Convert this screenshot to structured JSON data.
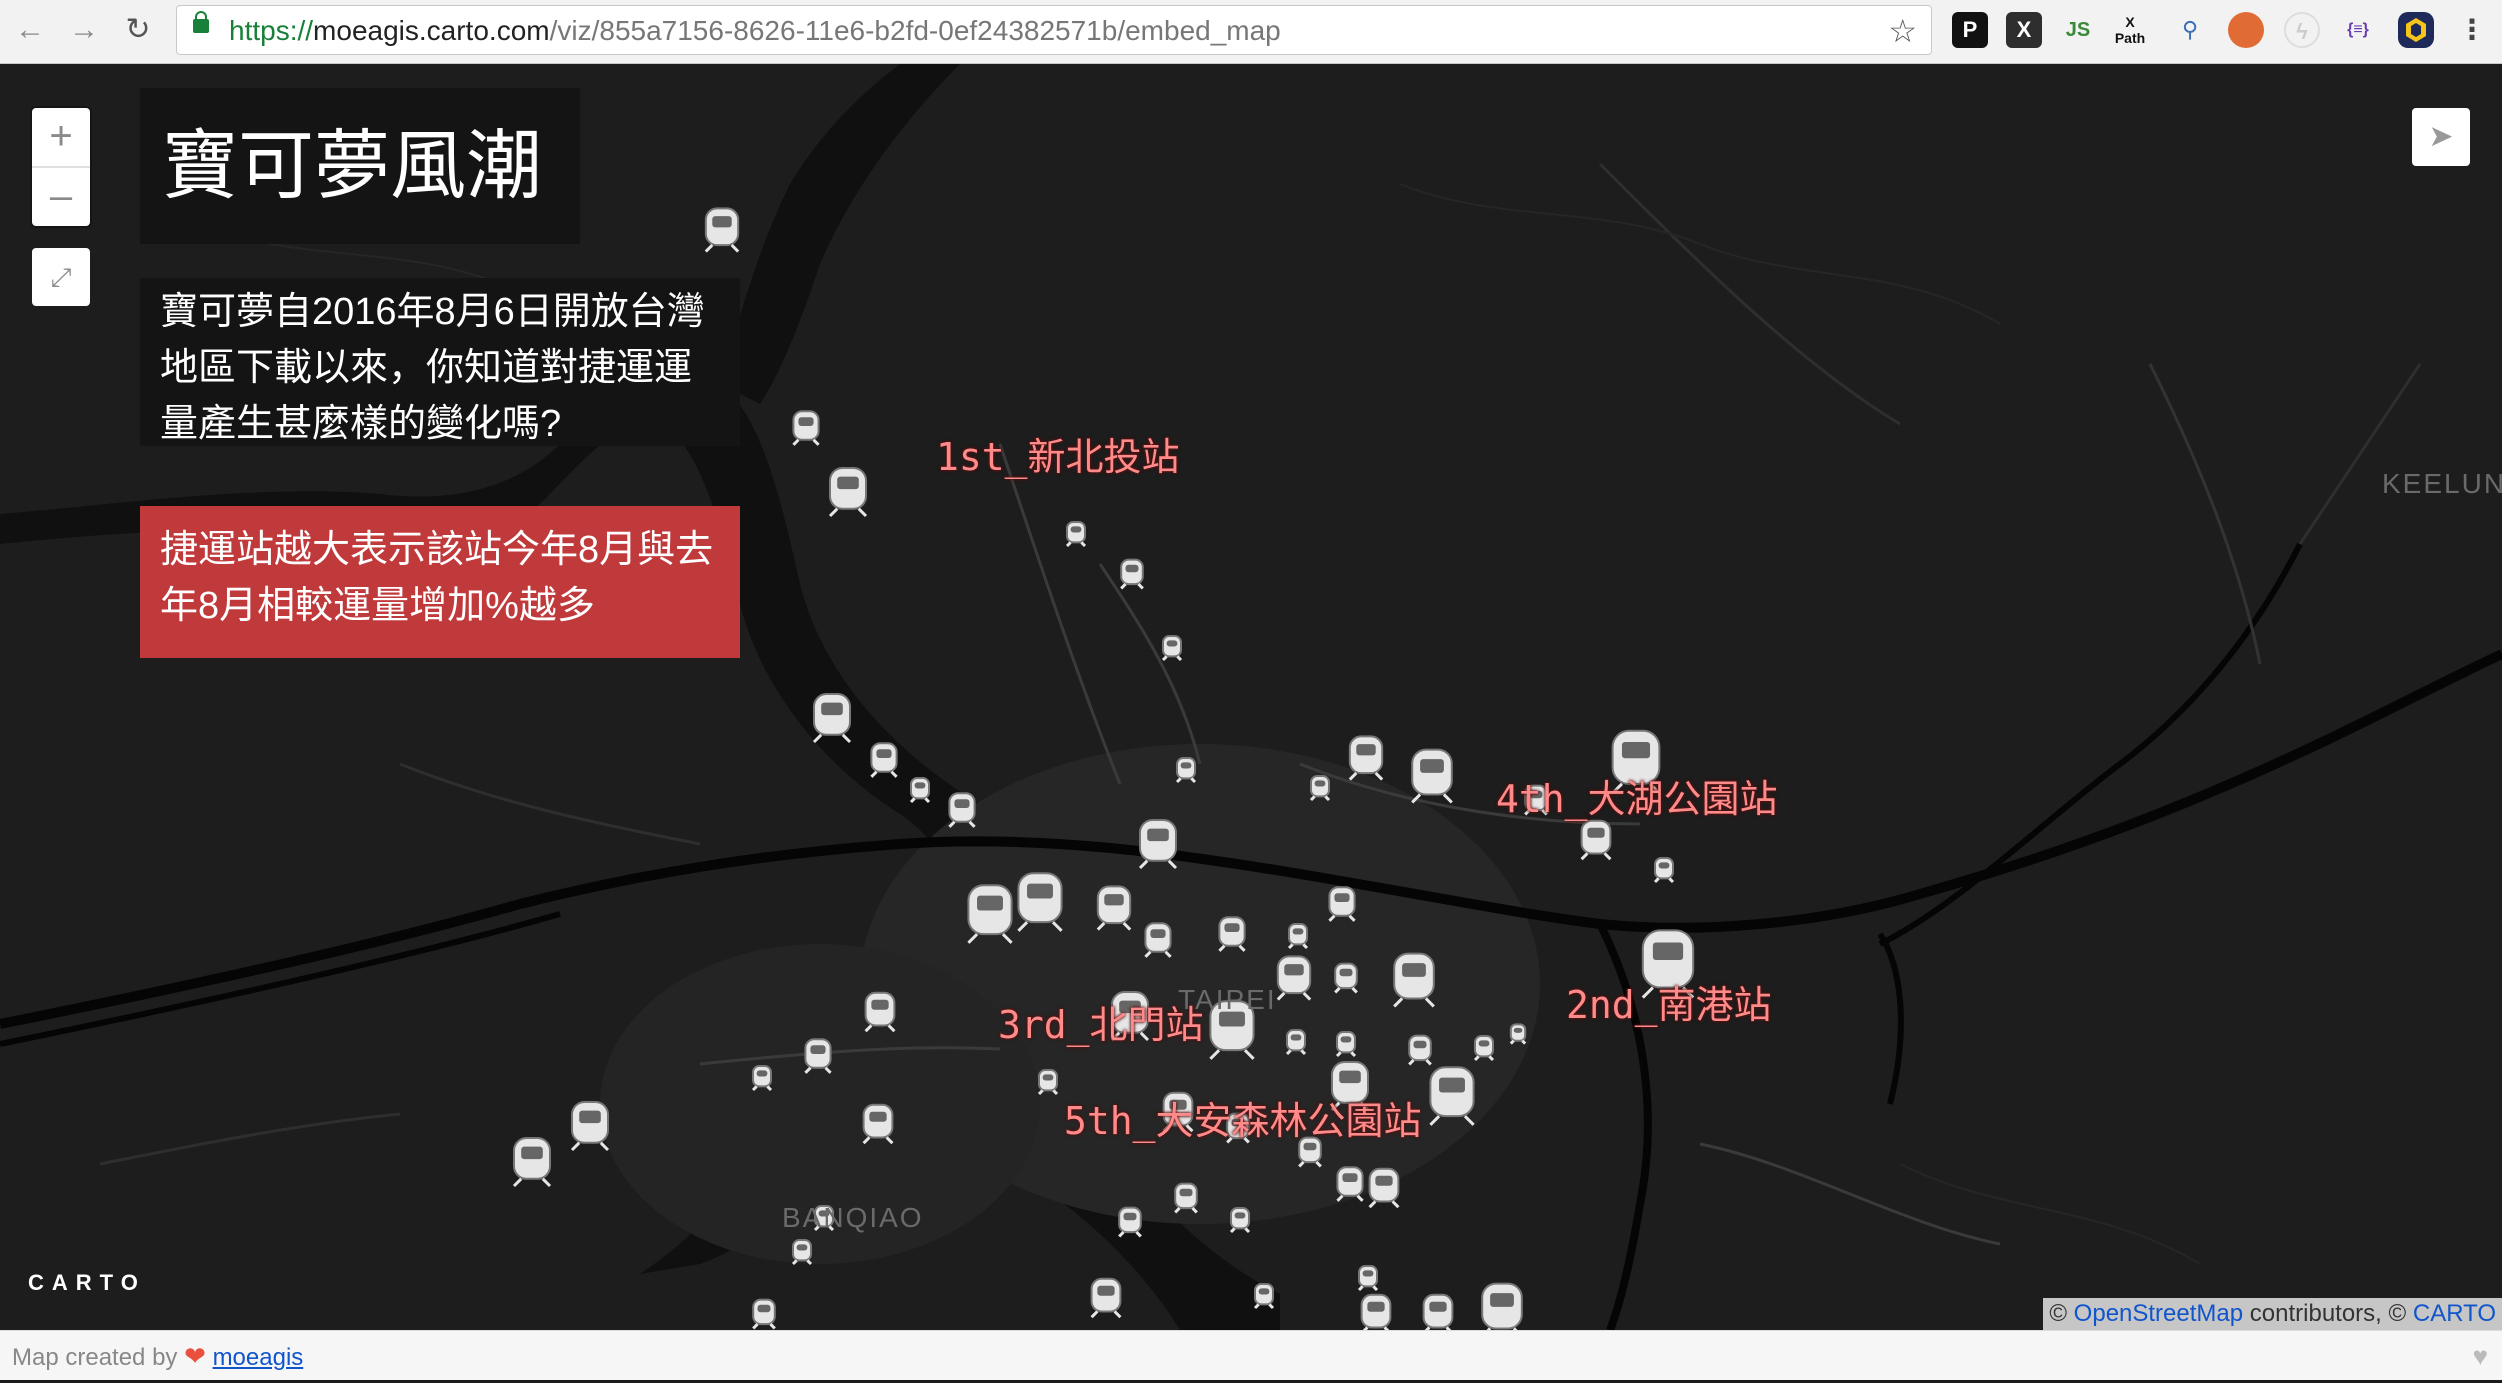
{
  "browser": {
    "back_icon": "arrow-left-icon",
    "url_scheme": "https://",
    "url_host": "moeagis.carto.com",
    "url_path": "/viz/855a7156-8626-11e6-b2fd-0ef24382571b/embed_map",
    "extensions": [
      "P",
      "X",
      "JS",
      "X Path",
      "",
      "",
      "",
      "{≡}",
      ""
    ]
  },
  "map": {
    "title": "寶可夢風潮",
    "description": "寶可夢自2016年8月6日開放台灣地區下載以來，你知道對捷運運量產生甚麼樣的變化嗎?",
    "legend_note": "捷運站越大表示該站今年8月與去年8月相較運量增加%越多",
    "zoom_in": "+",
    "zoom_out": "–",
    "station_labels": [
      "1st_新北投站",
      "4th_大湖公園站",
      "2nd_南港站",
      "3rd_北門站",
      "5th_大安森林公園站"
    ],
    "area_labels": [
      "TAIPEI",
      "BANQIAO",
      "KEELUNG"
    ],
    "logo": "CARTO",
    "attribution": {
      "prefix": "© ",
      "osm": "OpenStreetMap",
      "middle": " contributors, © ",
      "carto": "CARTO"
    },
    "accent_color": "#c0393b",
    "label_color": "#ff8a8a"
  },
  "footer": {
    "prefix": "Map created by",
    "author": "moeagis"
  }
}
